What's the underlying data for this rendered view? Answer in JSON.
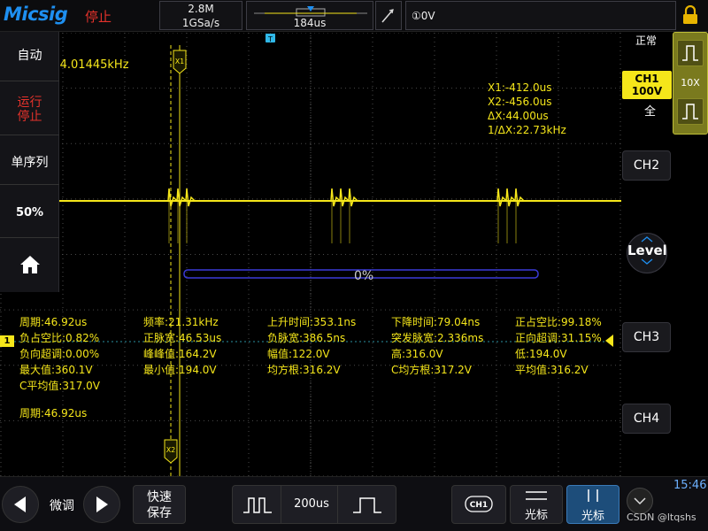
{
  "brand": "Micsig",
  "run_status": "停止",
  "acquisition": {
    "memory_depth": "2.8M",
    "sample_rate": "1GSa/s"
  },
  "timebase": {
    "value": "184us"
  },
  "trigger": {
    "level": "①0V",
    "slope_icon": "rising-edge-icon"
  },
  "left_menu": {
    "auto": "自动",
    "run": "运行",
    "stop": "停止",
    "single": "单序列",
    "fifty": "50%",
    "home_icon": "home-icon"
  },
  "ch1_freq": "CH1: 4.01445kHz",
  "cursor_info": {
    "x1": "X1:-412.0us",
    "x2": "X2:-456.0us",
    "dx": "ΔX:44.00us",
    "inv_dx": "1/ΔX:22.73kHz"
  },
  "progress": {
    "label": "0%",
    "fraction": 0
  },
  "trigger_marker": "T",
  "cursor_labels": {
    "x1": "X1",
    "x2": "X2"
  },
  "ch1_marker": "1",
  "measurements": [
    [
      "周期:46.92us",
      "频率:21.31kHz",
      "上升时间:353.1ns",
      "下降时间:79.04ns",
      "正占空比:99.18%"
    ],
    [
      "负占空比:0.82%",
      "正脉宽:46.53us",
      "负脉宽:386.5ns",
      "突发脉宽:2.336ms",
      "正向超调:31.15%"
    ],
    [
      "负向超调:0.00%",
      "峰峰值:164.2V",
      "幅值:122.0V",
      "高:316.0V",
      "低:194.0V"
    ],
    [
      "最大值:360.1V",
      "最小值:194.0V",
      "均方根:316.2V",
      "C均方根:317.2V",
      "平均值:316.2V"
    ],
    [
      "C平均值:317.0V"
    ]
  ],
  "period2": "周期:46.92us",
  "right_panel": {
    "trigger_mode": "正常",
    "ch1_badge_name": "CH1",
    "ch1_badge_scale": "100V",
    "ch1_bandwidth": "全",
    "probe_ratio": "10X",
    "ch2": "CH2",
    "ch3": "CH3",
    "ch4": "CH4",
    "level": "Level"
  },
  "bottom": {
    "fine_label": "微调",
    "save_label_1": "快速",
    "save_label_2": "保存",
    "timescale": "200us",
    "ch1": "CH1",
    "cursor_h": "光标",
    "cursor_v": "光标"
  },
  "clock": "15:46",
  "watermark": "CSDN @ltqshs",
  "colors": {
    "ch1": "#f5e61a",
    "stop": "#e4322b",
    "brand": "#1e8ff0",
    "cursor_v_active": "#1d4d7a"
  }
}
